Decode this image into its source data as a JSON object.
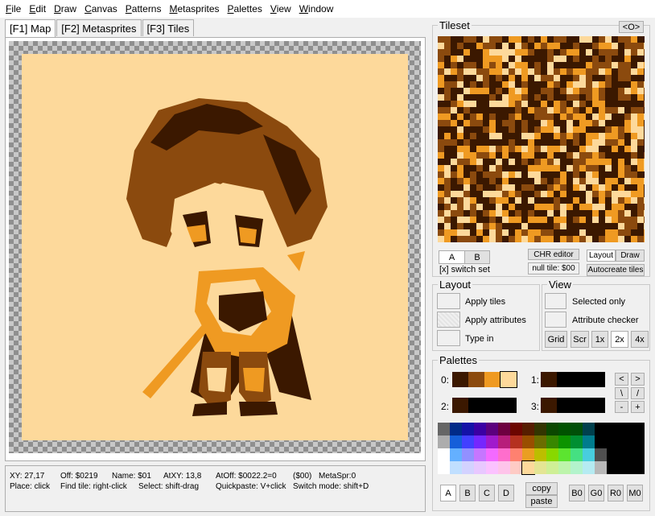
{
  "menu": [
    {
      "label": "File",
      "u": "F",
      "rest": "ile"
    },
    {
      "label": "Edit",
      "u": "E",
      "rest": "dit"
    },
    {
      "label": "Draw",
      "u": "D",
      "rest": "raw"
    },
    {
      "label": "Canvas",
      "u": "C",
      "rest": "anvas"
    },
    {
      "label": "Patterns",
      "u": "P",
      "rest": "atterns"
    },
    {
      "label": "Metasprites",
      "u": "M",
      "rest": "etasprites"
    },
    {
      "label": "Palettes",
      "u": "P",
      "rest": "alettes"
    },
    {
      "label": "View",
      "u": "V",
      "rest": "iew"
    },
    {
      "label": "Window",
      "u": "W",
      "rest": "indow"
    }
  ],
  "tabs": [
    "[F1] Map",
    "[F2] Metasprites",
    "[F3] Tiles"
  ],
  "status": {
    "xy": "XY: 27,17",
    "off": "Off: $0219",
    "name": "Name: $01",
    "atxy": "AtXY: 13,8",
    "atoff": "AtOff: $0022.2=0",
    "val": "($00)",
    "metaspr": "MetaSpr:0",
    "place": "Place: click",
    "findtile": "Find tile: right-click",
    "select": "Select: shift-drag",
    "quickpaste": "Quickpaste: V+click",
    "switchmode": "Switch mode: shift+D"
  },
  "tileset": {
    "title": "Tileset",
    "collapse": "<O>",
    "set_a": "A",
    "set_b": "B",
    "switch_set": "[x] switch set",
    "chr_editor": "CHR editor",
    "null_tile": "null tile: $00",
    "layout": "Layout",
    "draw": "Draw",
    "autocreate": "Autocreate tiles"
  },
  "layout": {
    "title": "Layout",
    "apply_tiles": "Apply tiles",
    "apply_attributes": "Apply attributes",
    "type_in": "Type in"
  },
  "view": {
    "title": "View",
    "selected_only": "Selected only",
    "attribute_checker": "Attribute checker",
    "grid": "Grid",
    "scr": "Scr",
    "z1": "1x",
    "z2": "2x",
    "z4": "4x"
  },
  "palettes": {
    "title": "Palettes",
    "p0": "0:",
    "p1": "1:",
    "p2": "2:",
    "p3": "3:",
    "prev": "<",
    "next": ">",
    "backslash": "\\",
    "slash": "/",
    "minus": "-",
    "plus": "+",
    "a": "A",
    "b": "B",
    "c": "C",
    "d": "D",
    "copy": "copy",
    "paste": "paste",
    "b0": "B0",
    "g0": "G0",
    "r0": "R0",
    "m0": "M0"
  },
  "colors": {
    "pal0": [
      "#3b1800",
      "#8b4a0e",
      "#ef9a22",
      "#fdd99b"
    ],
    "pal1": [
      "#3b1800",
      "#000000",
      "#000000",
      "#000000"
    ],
    "pal2": [
      "#3b1800",
      "#000000",
      "#000000",
      "#000000"
    ],
    "pal3": [
      "#3b1800",
      "#000000",
      "#000000",
      "#000000"
    ],
    "nes_rows": [
      [
        "#666666",
        "#002a88",
        "#1412a7",
        "#3b00a4",
        "#5c007e",
        "#6e0040",
        "#6c0600",
        "#561d00",
        "#333500",
        "#0b4800",
        "#005200",
        "#004f08",
        "#00404d",
        "#000000"
      ],
      [
        "#adadad",
        "#155fd9",
        "#4240ff",
        "#7527fe",
        "#a01acc",
        "#b71e7b",
        "#b53120",
        "#994e00",
        "#6b6d00",
        "#388700",
        "#0c9300",
        "#008f32",
        "#007c8d",
        "#000000"
      ],
      [
        "#ffffff",
        "#64b0ff",
        "#9290ff",
        "#c676ff",
        "#f36aff",
        "#fe6ecc",
        "#fe8170",
        "#ea9e22",
        "#bcbe00",
        "#88d800",
        "#5ce430",
        "#45e082",
        "#48cdde",
        "#4f4f4f"
      ],
      [
        "#ffffff",
        "#c0dfff",
        "#d3d2ff",
        "#e8c8ff",
        "#fbc2ff",
        "#fec4ea",
        "#fecbc5",
        "#fdd99b",
        "#e4e594",
        "#cfef96",
        "#bdf4ab",
        "#b3f3cc",
        "#b5ebf2",
        "#b8b8b8"
      ]
    ]
  }
}
